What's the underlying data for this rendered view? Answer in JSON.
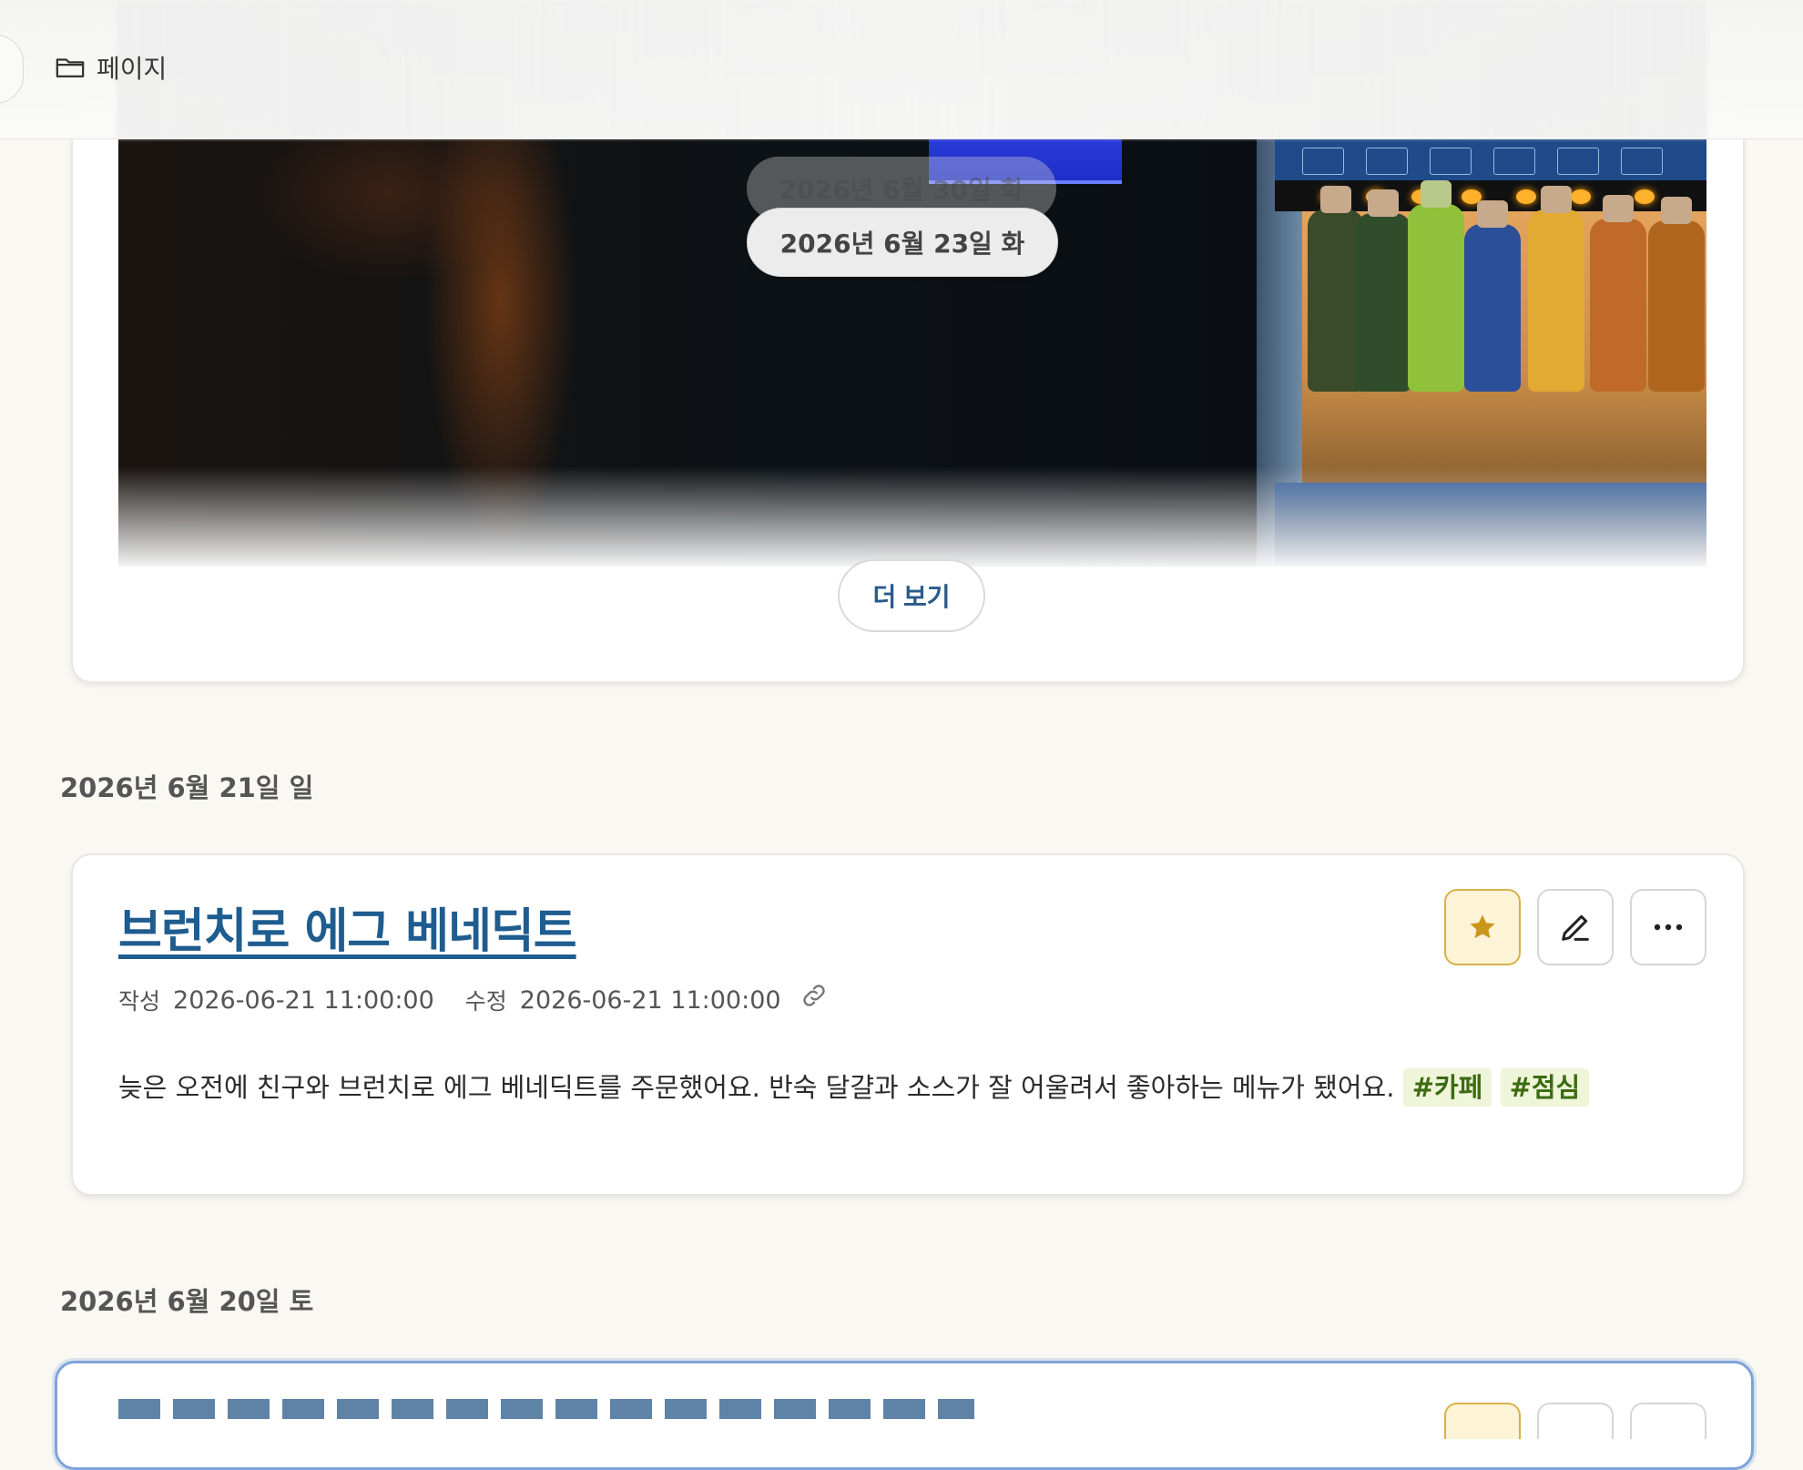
{
  "header": {
    "breadcrumb_label": "페이지",
    "breadcrumb_icon": "folder-icon"
  },
  "entry_top": {
    "scroll_date_ghost": "2026년 6월 30일 화",
    "scroll_date": "2026년 6월 23일 화",
    "more_label": "더 보기"
  },
  "groups": [
    {
      "date_label": "2026년 6월 21일 일"
    },
    {
      "date_label": "2026년 6월 20일 토"
    }
  ],
  "entry": {
    "title": "브런치로 에그 베네딕트",
    "created_label": "작성",
    "created_at": "2026-06-21 11:00:00",
    "updated_label": "수정",
    "updated_at": "2026-06-21 11:00:00",
    "body": "늦은 오전에 친구와 브런치로 에그 베네딕트를 주문했어요. 반숙 달걀과 소스가 잘 어울려서 좋아하는 메뉴가 됐어요.",
    "tags": [
      "#카페",
      "#점심"
    ],
    "actions": {
      "favorite_icon": "star-icon",
      "edit_icon": "pencil-icon",
      "more_icon": "more-horizontal-icon"
    }
  },
  "colors": {
    "background": "#f9f8f3",
    "title_link": "#1f5c8f",
    "tag_bg": "#eef5d9",
    "tag_text": "#3c6b12",
    "favorite_accent": "#c9961c",
    "focus_border": "#7ea3d9"
  }
}
